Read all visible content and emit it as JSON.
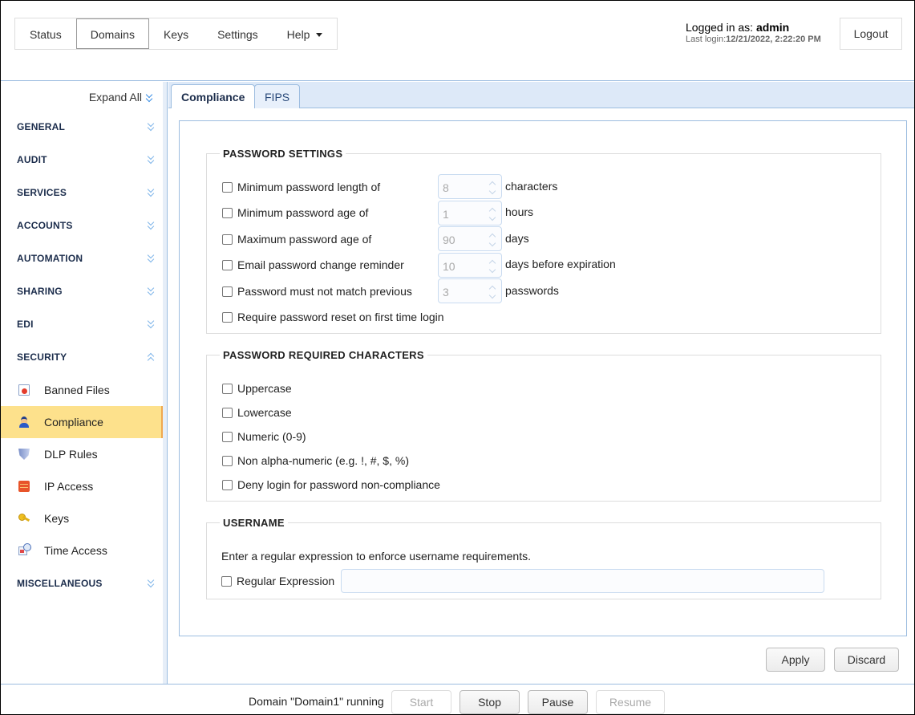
{
  "topnav": {
    "items": [
      {
        "label": "Status",
        "active": false
      },
      {
        "label": "Domains",
        "active": true
      },
      {
        "label": "Keys",
        "active": false
      },
      {
        "label": "Settings",
        "active": false
      },
      {
        "label": "Help",
        "active": false,
        "has_dropdown": true
      }
    ]
  },
  "user": {
    "logged_in_prefix": "Logged in as: ",
    "username": "admin",
    "last_login_prefix": "Last login:",
    "last_login": "12/21/2022, 2:22:20 PM",
    "logout_label": "Logout"
  },
  "sidebar": {
    "expand_all_label": "Expand All",
    "sections": [
      {
        "label": "GENERAL",
        "expanded": false
      },
      {
        "label": "AUDIT",
        "expanded": false
      },
      {
        "label": "SERVICES",
        "expanded": false
      },
      {
        "label": "ACCOUNTS",
        "expanded": false
      },
      {
        "label": "AUTOMATION",
        "expanded": false
      },
      {
        "label": "SHARING",
        "expanded": false
      },
      {
        "label": "EDI",
        "expanded": false
      },
      {
        "label": "SECURITY",
        "expanded": true
      },
      {
        "label": "MISCELLANEOUS",
        "expanded": false
      }
    ],
    "security_items": [
      {
        "label": "Banned Files",
        "icon": "banned-file-icon",
        "active": false
      },
      {
        "label": "Compliance",
        "icon": "officer-icon",
        "active": true
      },
      {
        "label": "DLP Rules",
        "icon": "shield-icon",
        "active": false
      },
      {
        "label": "IP Access",
        "icon": "firewall-icon",
        "active": false
      },
      {
        "label": "Keys",
        "icon": "key-icon",
        "active": false
      },
      {
        "label": "Time Access",
        "icon": "calendar-clock-icon",
        "active": false
      }
    ]
  },
  "tabs": [
    {
      "label": "Compliance",
      "active": true
    },
    {
      "label": "FIPS",
      "active": false
    }
  ],
  "password_settings": {
    "title": "PASSWORD SETTINGS",
    "rows": [
      {
        "label": "Minimum password length of",
        "checked": false,
        "value": "8",
        "unit": "characters"
      },
      {
        "label": "Minimum password age of",
        "checked": false,
        "value": "1",
        "unit": "hours"
      },
      {
        "label": "Maximum password age of",
        "checked": false,
        "value": "90",
        "unit": "days"
      },
      {
        "label": "Email password change reminder",
        "checked": false,
        "value": "10",
        "unit": "days before expiration"
      },
      {
        "label": "Password must not match previous",
        "checked": false,
        "value": "3",
        "unit": "passwords"
      },
      {
        "label": "Require password reset on first time login",
        "checked": false
      }
    ]
  },
  "required_characters": {
    "title": "PASSWORD REQUIRED CHARACTERS",
    "rows": [
      {
        "label": "Uppercase",
        "checked": false
      },
      {
        "label": "Lowercase",
        "checked": false
      },
      {
        "label": "Numeric (0-9)",
        "checked": false
      },
      {
        "label": "Non alpha-numeric (e.g. !, #, $, %)",
        "checked": false
      },
      {
        "label": "Deny login for password non-compliance",
        "checked": false
      }
    ]
  },
  "username": {
    "title": "USERNAME",
    "hint": "Enter a regular expression to enforce username requirements.",
    "regex_label": "Regular Expression",
    "regex_checked": false,
    "regex_value": ""
  },
  "actions": {
    "apply_label": "Apply",
    "discard_label": "Discard"
  },
  "footer": {
    "status": "Domain \"Domain1\" running",
    "buttons": [
      {
        "label": "Start",
        "enabled": false
      },
      {
        "label": "Stop",
        "enabled": true
      },
      {
        "label": "Pause",
        "enabled": true
      },
      {
        "label": "Resume",
        "enabled": false
      }
    ]
  },
  "colors": {
    "accent_border": "#9dbde0",
    "active_item_bg": "#fde18c",
    "active_item_edge": "#f0a850",
    "section_label": "#1c2d4c",
    "chevron": "#3a8ee6"
  }
}
